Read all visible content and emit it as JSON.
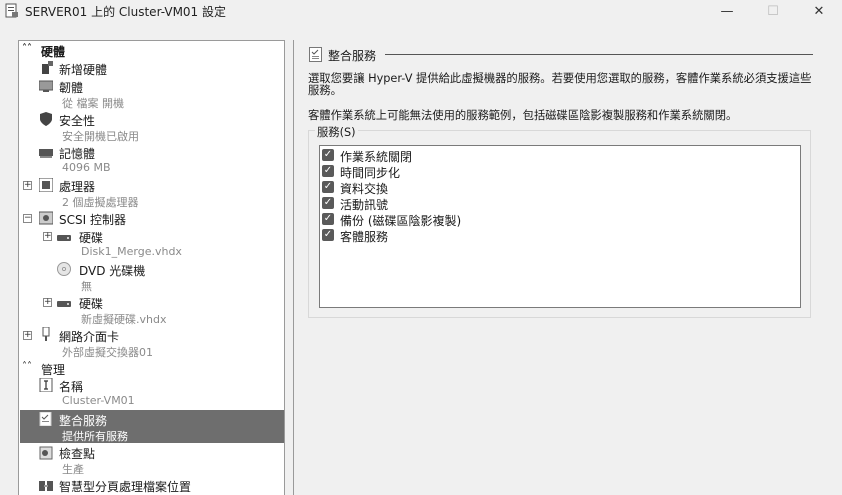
{
  "window": {
    "title": "SERVER01 上的 Cluster-VM01 設定",
    "minimize": "—",
    "maximize": "☐",
    "close": "✕"
  },
  "tree": {
    "hardware_header": "硬體",
    "management_header": "管理",
    "items": {
      "add_hardware": {
        "title": "新增硬體"
      },
      "firmware": {
        "title": "韌體",
        "sub": "從 檔案 開機"
      },
      "security": {
        "title": "安全性",
        "sub": "安全開機已啟用"
      },
      "memory": {
        "title": "記憶體",
        "sub": "4096 MB"
      },
      "processor": {
        "title": "處理器",
        "sub": "2 個虛擬處理器"
      },
      "scsi": {
        "title": "SCSI 控制器"
      },
      "hdd1": {
        "title": "硬碟",
        "sub": "Disk1_Merge.vhdx"
      },
      "dvd": {
        "title": "DVD 光碟機",
        "sub": "無"
      },
      "hdd2": {
        "title": "硬碟",
        "sub": "新虛擬硬碟.vhdx"
      },
      "nic": {
        "title": "網路介面卡",
        "sub": "外部虛擬交換器01"
      },
      "name": {
        "title": "名稱",
        "sub": "Cluster-VM01"
      },
      "integration": {
        "title": "整合服務",
        "sub": "提供所有服務"
      },
      "checkpoints": {
        "title": "檢查點",
        "sub": "生產"
      },
      "paging": {
        "title": "智慧型分頁處理檔案位置"
      }
    }
  },
  "panel": {
    "title": "整合服務",
    "desc1": "選取您要讓 Hyper-V 提供給此虛擬機器的服務。若要使用您選取的服務，客體作業系統必須支援這些服務。",
    "desc2": "客體作業系統上可能無法使用的服務範例，包括磁碟區陰影複製服務和作業系統關閉。",
    "services_label": "服務(S)",
    "services": [
      {
        "label": "作業系統關閉",
        "checked": true
      },
      {
        "label": "時間同步化",
        "checked": true
      },
      {
        "label": "資料交換",
        "checked": true
      },
      {
        "label": "活動訊號",
        "checked": true
      },
      {
        "label": "備份 (磁碟區陰影複製)",
        "checked": true
      },
      {
        "label": "客體服務",
        "checked": true
      }
    ]
  }
}
